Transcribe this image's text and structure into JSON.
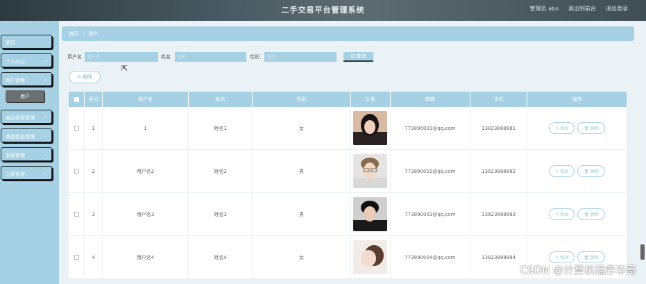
{
  "header": {
    "title": "二手交易平台管理系统",
    "admin_label": "管理员 abo",
    "front_label": "退出到前台",
    "logout_label": "退出登录"
  },
  "sidebar": {
    "items": [
      {
        "label": "首页",
        "has_chevron": false
      },
      {
        "label": "个人中心",
        "has_chevron": true
      },
      {
        "label": "用户管理",
        "has_chevron": true
      },
      {
        "label": "商品类型管理",
        "has_chevron": true
      },
      {
        "label": "商品信息管理",
        "has_chevron": true
      },
      {
        "label": "系统管理",
        "has_chevron": true
      },
      {
        "label": "订单管理",
        "has_chevron": true
      }
    ],
    "active_sub": "用户"
  },
  "breadcrumb": {
    "home": "首页",
    "sep": "/",
    "current": "用户"
  },
  "search": {
    "username_label": "用户名",
    "username_placeholder": "用户名",
    "name_label": "姓名",
    "name_placeholder": "姓名",
    "gender_label": "性别",
    "gender_placeholder": "性别",
    "button_label": "Q 查询"
  },
  "toolbar": {
    "delete_label": "⊖ 删除"
  },
  "table": {
    "headers": [
      "索引",
      "用户名",
      "姓名",
      "性别",
      "头像",
      "邮箱",
      "手机",
      "操作"
    ],
    "rows": [
      {
        "index": "1",
        "username": "1",
        "name": "姓名1",
        "gender": "女",
        "email": "773890001@qq.com",
        "phone": "13823888881"
      },
      {
        "index": "2",
        "username": "用户名2",
        "name": "姓名2",
        "gender": "男",
        "email": "773890002@qq.com",
        "phone": "13823888882"
      },
      {
        "index": "3",
        "username": "用户名3",
        "name": "姓名3",
        "gender": "男",
        "email": "773890003@qq.com",
        "phone": "13823888883"
      },
      {
        "index": "4",
        "username": "用户名4",
        "name": "姓名4",
        "gender": "女",
        "email": "773890004@qq.com",
        "phone": "13823888884"
      }
    ],
    "edit_label": "✎ 修改",
    "delete_label": "🗑 删除"
  },
  "colors": {
    "accent": "#a6d0e4",
    "header_bg": "#3f4d55",
    "page_bg": "#eaf2f6"
  },
  "watermark": "CSDN @计算机程序华哥"
}
